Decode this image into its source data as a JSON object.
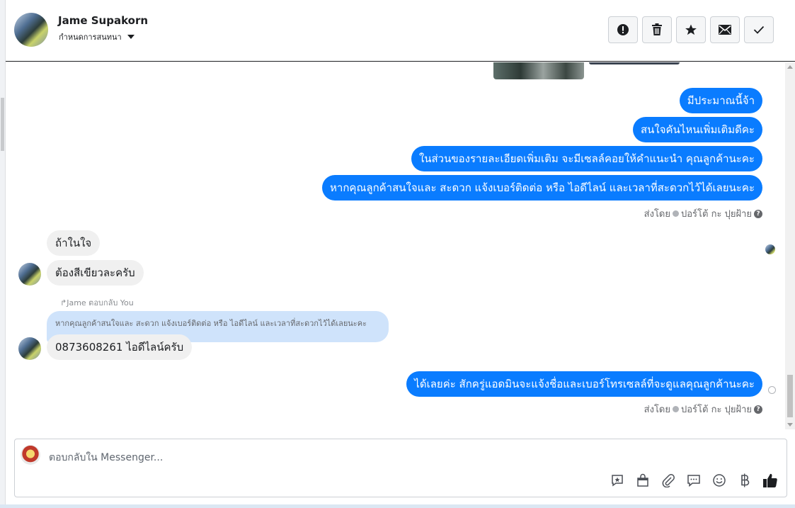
{
  "header": {
    "contact_name": "Jame Supakorn",
    "assign_label": "กำหนดการสนทนา",
    "actions": [
      {
        "icon": "alert-icon",
        "name": "mark-spam-button"
      },
      {
        "icon": "trash-icon",
        "name": "delete-button"
      },
      {
        "icon": "star-icon",
        "name": "star-button"
      },
      {
        "icon": "envelope-icon",
        "name": "mark-unread-button"
      },
      {
        "icon": "check-icon",
        "name": "mark-done-button"
      }
    ]
  },
  "messages": {
    "out_1": "มีประมาณนี้จ้า",
    "out_2": "สนใจคันไหนเพิ่มเติมดีคะ",
    "out_3": "ในส่วนของรายละเอียดเพิ่มเติม จะมีเซลล์คอยให้คำแนะนำ คุณลูกค้านะคะ",
    "out_4": "หากคุณลูกค้าสนใจและ สะดวก แจ้งเบอร์ติดต่อ หรือ ไอดีไลน์ และเวลาที่สะดวกไว้ได้เลยนะคะ",
    "sent_by_1": "ส่งโดย",
    "sent_by_name_1": "ปอร์โต้ กะ ปุยฝ้าย",
    "in_1": "ถ้าในใจ",
    "in_2": "ต้องสีเขียวละครับ",
    "reply_label": "Jame ตอบกลับ You",
    "quoted_text": "หากคุณลูกค้าสนใจและ สะดวก แจ้งเบอร์ติดต่อ หรือ ไอดีไลน์ และเวลาที่สะดวกไว้ได้เลยนะคะ",
    "in_3": "0873608261 ไอดีไลน์ครับ",
    "out_5": "ได้เลยค่ะ สักครู่แอดมินจะแจ้งชื่อและเบอร์โทรเซลล์ที่จะดูแลคุณลูกค้านะคะ",
    "sent_by_2": "ส่งโดย",
    "sent_by_name_2": "ปอร์โต้ กะ ปุยฝ้าย"
  },
  "composer": {
    "placeholder": "ตอบกลับใน Messenger...",
    "tools": [
      "saved-reply-icon",
      "shop-icon",
      "attachment-icon",
      "chat-bubble-icon",
      "emoji-icon",
      "baht-icon",
      "like-icon"
    ]
  },
  "colors": {
    "accent": "#0a7cff",
    "incoming_bubble": "#f0f0f0",
    "quoted_bg": "#cfe3fb"
  }
}
